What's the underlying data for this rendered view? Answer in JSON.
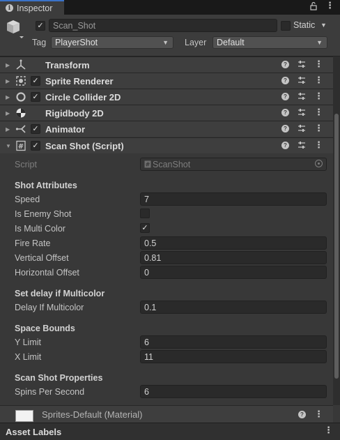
{
  "tab": {
    "label": "Inspector"
  },
  "header": {
    "object_name": "Scan_Shot",
    "static_label": "Static",
    "tag_label": "Tag",
    "tag_value": "PlayerShot",
    "layer_label": "Layer",
    "layer_value": "Default"
  },
  "components": [
    {
      "title": "Transform"
    },
    {
      "title": "Sprite Renderer"
    },
    {
      "title": "Circle Collider 2D"
    },
    {
      "title": "Rigidbody 2D"
    },
    {
      "title": "Animator"
    },
    {
      "title": "Scan Shot (Script)"
    }
  ],
  "script_field": {
    "label": "Script",
    "value": "ScanShot"
  },
  "sections": {
    "shot_attributes": "Shot Attributes",
    "set_delay": "Set delay if Multicolor",
    "space_bounds": "Space Bounds",
    "scan_shot_properties": "Scan Shot Properties"
  },
  "fields": {
    "speed": {
      "label": "Speed",
      "value": "7"
    },
    "is_enemy_shot": {
      "label": "Is Enemy Shot",
      "checked": false
    },
    "is_multi_color": {
      "label": "Is Multi Color",
      "checked": true
    },
    "fire_rate": {
      "label": "Fire Rate",
      "value": "0.5"
    },
    "vertical_offset": {
      "label": "Vertical Offset",
      "value": "0.81"
    },
    "horizontal_offset": {
      "label": "Horizontal Offset",
      "value": "0"
    },
    "delay_if_multicolor": {
      "label": "Delay If Multicolor",
      "value": "0.1"
    },
    "y_limit": {
      "label": "Y Limit",
      "value": "6"
    },
    "x_limit": {
      "label": "X Limit",
      "value": "11"
    },
    "spins_per_second": {
      "label": "Spins Per Second",
      "value": "6"
    }
  },
  "material": {
    "title": "Sprites-Default (Material)"
  },
  "asset_labels": {
    "label": "Asset Labels"
  },
  "icons": {
    "lock": "lock-icon",
    "menu": "kebab-menu-icon",
    "help": "help-icon",
    "presets": "presets-sliders-icon"
  },
  "colors": {
    "background": "#383838",
    "header": "#3c3c3c",
    "field": "#2a2a2a",
    "accent": "#3a72c8"
  }
}
